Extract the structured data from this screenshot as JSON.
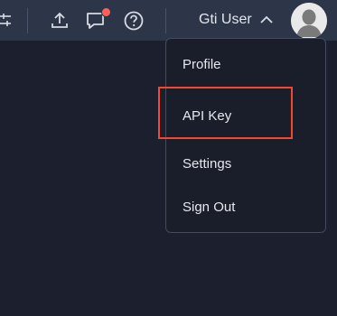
{
  "topbar": {
    "user_name": "Gti User",
    "notification_badge_color": "#ff5f56"
  },
  "user_menu": {
    "items": [
      {
        "label": "Profile"
      },
      {
        "label": "API Key"
      },
      {
        "label": "Settings"
      },
      {
        "label": "Sign Out"
      }
    ],
    "highlighted_item": "API Key",
    "highlight_color": "#f0492b"
  },
  "icons": {
    "filter": "sliders-icon",
    "upload": "upload-icon",
    "chat": "chat-icon",
    "help": "help-icon",
    "caret": "chevron-up-icon",
    "avatar": "avatar-icon"
  }
}
